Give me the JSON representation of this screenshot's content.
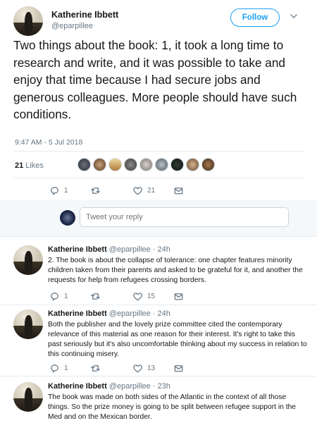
{
  "main": {
    "name": "Katherine Ibbett",
    "handle": "@eparpillee",
    "follow_label": "Follow",
    "text": "Two things about the book: 1, it took a long time to research and write, and it was possible to take and enjoy that time because I had secure jobs and generous colleagues. More people should have such conditions.",
    "timestamp": "9:47 AM - 5 Jul 2018",
    "likes_count": "21",
    "likes_label": "Likes",
    "reply_count": "1",
    "retweet_count": "",
    "like_count": "21"
  },
  "reply_box": {
    "placeholder": "Tweet your reply"
  },
  "replies": [
    {
      "name": "Katherine Ibbett",
      "handle": "@eparpillee",
      "time": "24h",
      "text": "2. The book is about the collapse of tolerance: one chapter features minority children taken from their parents and asked to be grateful for it, and another the requests for help from refugees crossing borders.",
      "reply_count": "1",
      "like_count": "15"
    },
    {
      "name": "Katherine Ibbett",
      "handle": "@eparpillee",
      "time": "24h",
      "text": "Both the publisher and the lovely prize committee cited the contemporary relevance of this material  as one reason for their interest. It's right to take this past seriously but it's also uncomfortable thinking about my success in relation to this continuing misery.",
      "reply_count": "1",
      "like_count": "13"
    },
    {
      "name": "Katherine Ibbett",
      "handle": "@eparpillee",
      "time": "23h",
      "text": "The book was made on both sides of the Atlantic in the context of all those things. So the prize money is going to be split between refugee support in the Med and on the Mexican border."
    }
  ],
  "icons": {
    "reply": "reply-icon",
    "retweet": "retweet-icon",
    "like": "heart-icon",
    "dm": "envelope-icon",
    "chevron": "chevron-down-icon"
  },
  "colors": {
    "accent": "#1da1f2",
    "muted": "#657786",
    "text": "#14171a",
    "divider": "#e6ecf0"
  }
}
